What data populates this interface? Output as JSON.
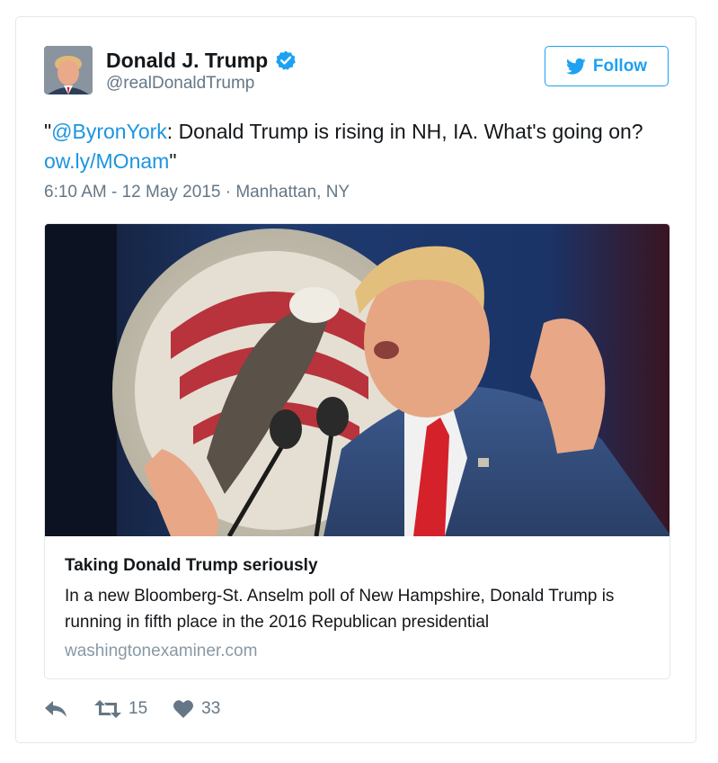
{
  "author": {
    "display_name": "Donald J. Trump",
    "handle": "@realDonaldTrump",
    "verified": true
  },
  "follow_button": {
    "label": "Follow",
    "icon": "bird-icon"
  },
  "tweet": {
    "text_open_quote": "\"",
    "mention": "@ByronYork",
    "text_body": ": Donald Trump is rising in NH, IA. What's going on? ",
    "link": "ow.ly/MOnam",
    "text_close_quote": "\"",
    "timestamp": "6:10 AM - 12 May 2015",
    "separator": " · ",
    "location": "Manhattan, NY"
  },
  "card": {
    "title": "Taking Donald Trump seriously",
    "description": "In a new Bloomberg-St. Anselm poll of New Hampshire, Donald Trump is running in fifth place in the 2016 Republican presidential",
    "domain": "washingtonexaminer.com"
  },
  "actions": {
    "reply_icon": "reply-icon",
    "retweet_icon": "retweet-icon",
    "retweet_count": "15",
    "like_icon": "heart-icon",
    "like_count": "33"
  },
  "colors": {
    "accent": "#1da1f2",
    "link": "#1b95e0",
    "muted": "#657786",
    "border": "#e1e8ed"
  }
}
